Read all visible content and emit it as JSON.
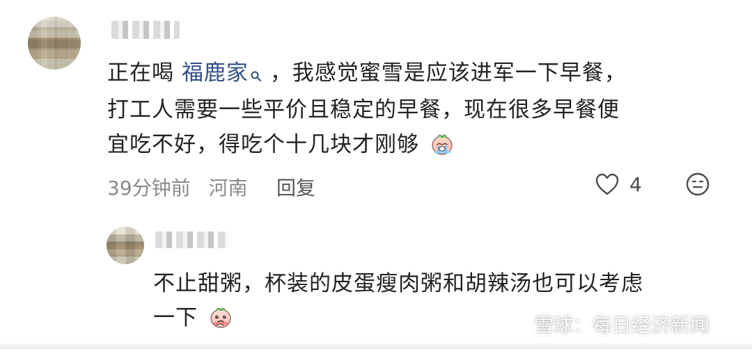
{
  "comment_1": {
    "text_line_1_prefix": "正在喝",
    "link_text": "福鹿家",
    "text_line_1_suffix": "，我感觉蜜雪是应该进军一下早餐，",
    "text_line_2": "打工人需要一些平价且稳定的早餐，现在很多早餐便",
    "text_line_3": "宜吃不好，得吃个十几块才刚够",
    "time": "39分钟前",
    "location": "河南",
    "reply_label": "回复",
    "like_count": "4",
    "emoji_icon": "crying-emoji-icon"
  },
  "reply_1": {
    "text_line_1": "不止甜粥，杯装的皮蛋瘦肉粥和胡辣汤也可以考虑",
    "text_line_2": "一下",
    "emoji_icon": "pleading-emoji-icon"
  },
  "watermark": {
    "text": "雪球：每日经济新闻"
  },
  "colors": {
    "link": "#2f4f86",
    "text": "#222222",
    "meta": "#8a8a8a"
  }
}
